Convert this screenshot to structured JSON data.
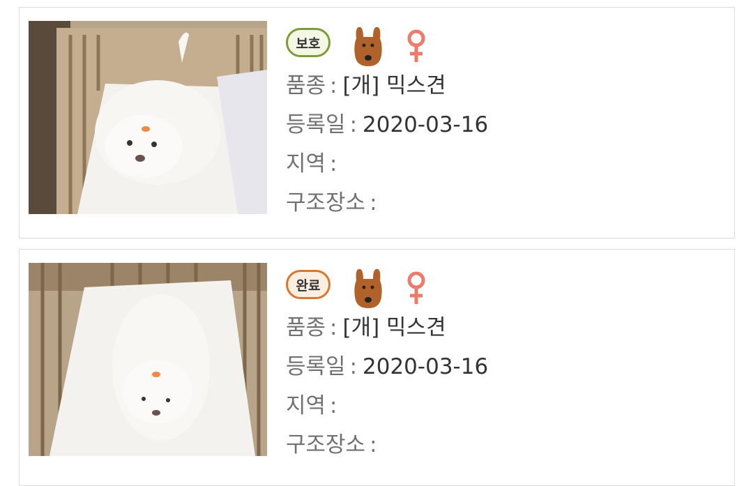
{
  "items": [
    {
      "status_badge": "보호",
      "status_color": "#7f9a3a",
      "animal_icon": "dog-icon",
      "gender_icon": "female-icon",
      "gender_color": "#f07a6a",
      "fields": [
        {
          "label": "품종",
          "value": "[개] 믹스견"
        },
        {
          "label": "등록일",
          "value": "2020-03-16"
        },
        {
          "label": "지역",
          "value": ""
        },
        {
          "label": "구조장소",
          "value": ""
        }
      ]
    },
    {
      "status_badge": "완료",
      "status_color": "#d9772d",
      "animal_icon": "dog-icon",
      "gender_icon": "female-icon",
      "gender_color": "#f07a6a",
      "fields": [
        {
          "label": "품종",
          "value": "[개] 믹스견"
        },
        {
          "label": "등록일",
          "value": "2020-03-16"
        },
        {
          "label": "지역",
          "value": ""
        },
        {
          "label": "구조장소",
          "value": ""
        }
      ]
    }
  ],
  "separator": ":"
}
